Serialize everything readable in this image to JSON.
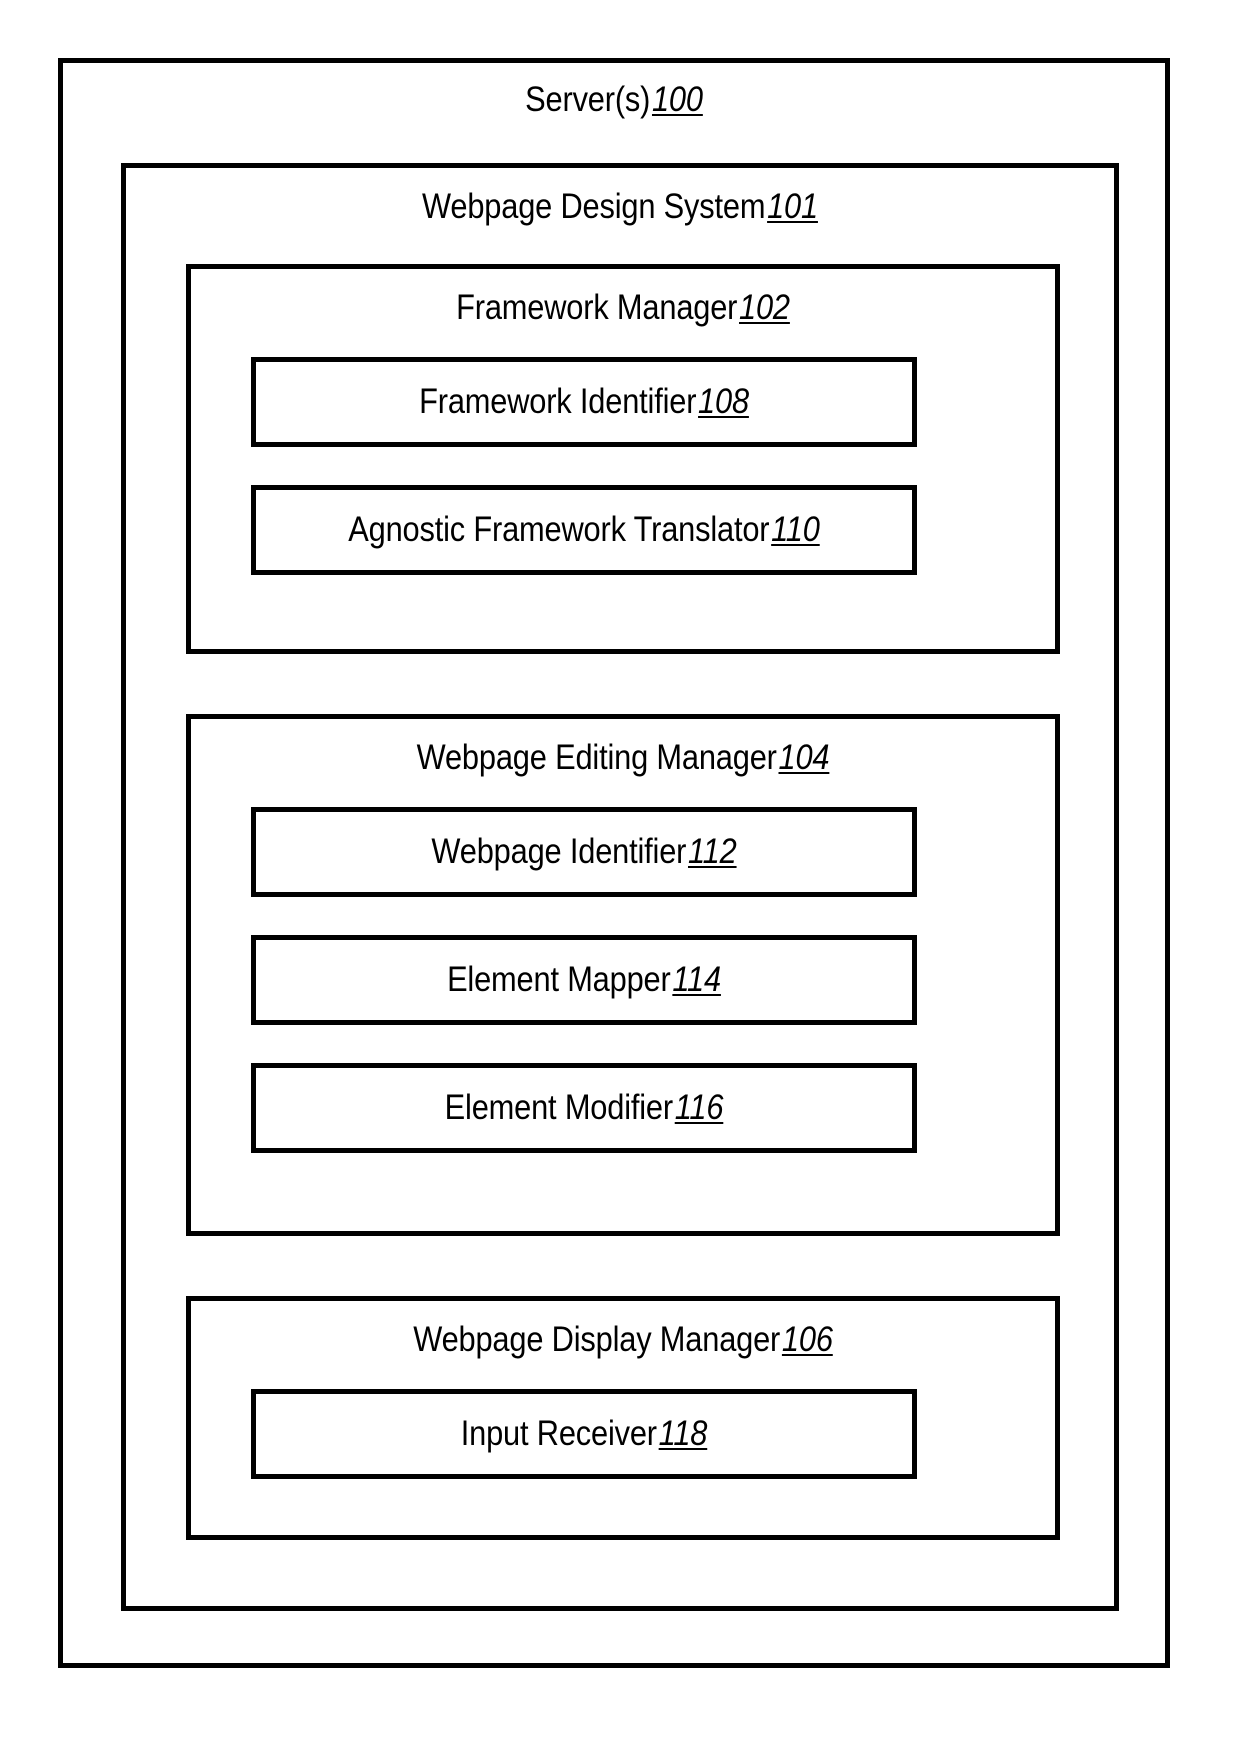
{
  "figure": {
    "type": "patent-block-diagram",
    "background_color": "#ffffff",
    "line_color": "#000000"
  },
  "server": {
    "label": "Server(s)",
    "ref": "100",
    "design_system": {
      "label": "Webpage Design System",
      "ref": "101",
      "managers": [
        {
          "name": "framework-manager",
          "label": "Framework Manager",
          "ref": "102",
          "components": [
            {
              "name": "framework-identifier",
              "label": "Framework Identifier",
              "ref": "108"
            },
            {
              "name": "agnostic-framework-translator",
              "label": "Agnostic Framework Translator",
              "ref": "110"
            }
          ]
        },
        {
          "name": "webpage-editing-manager",
          "label": "Webpage Editing Manager",
          "ref": "104",
          "components": [
            {
              "name": "webpage-identifier",
              "label": "Webpage Identifier",
              "ref": "112"
            },
            {
              "name": "element-mapper",
              "label": "Element Mapper",
              "ref": "114"
            },
            {
              "name": "element-modifier",
              "label": "Element Modifier",
              "ref": "116"
            }
          ]
        },
        {
          "name": "webpage-display-manager",
          "label": "Webpage Display Manager",
          "ref": "106",
          "components": [
            {
              "name": "input-receiver",
              "label": "Input Receiver",
              "ref": "118"
            }
          ]
        }
      ]
    }
  }
}
